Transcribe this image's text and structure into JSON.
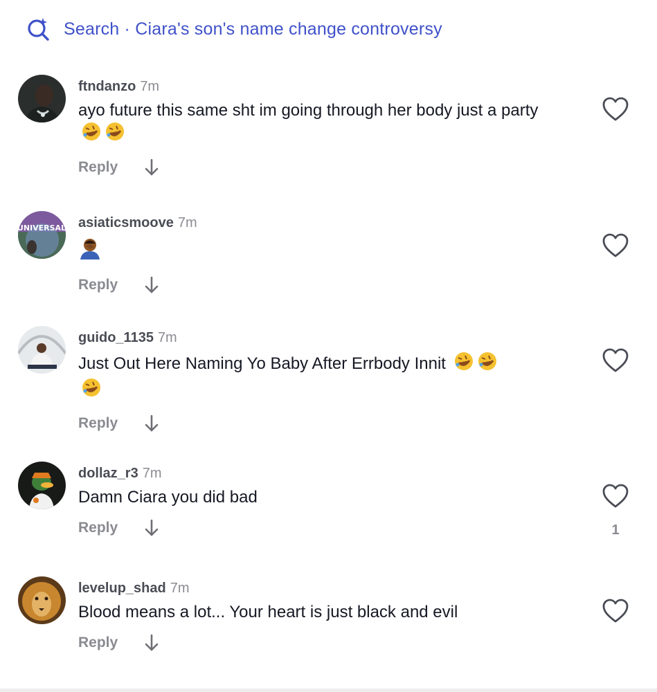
{
  "search": {
    "label": "Search · Ciara's son's name change controversy",
    "icon": "search-sparkle-icon",
    "color": "#3f51c9"
  },
  "comments": [
    {
      "username": "ftndanzo",
      "time": "7m",
      "text": "ayo future this same sht im going through her body just a party",
      "emojis": [
        "rofl-emoji",
        "rofl-emoji"
      ],
      "reply": "Reply",
      "likes": ""
    },
    {
      "username": "asiaticsmoove",
      "time": "7m",
      "text": "",
      "emojis": [
        "facepalm-emoji"
      ],
      "reply": "Reply",
      "likes": ""
    },
    {
      "username": "guido_1135",
      "time": "7m",
      "text": "Just Out Here Naming Yo Baby After Errbody Innit",
      "emojis": [
        "rofl-emoji",
        "rofl-emoji",
        "rofl-emoji"
      ],
      "reply": "Reply",
      "likes": ""
    },
    {
      "username": "dollaz_r3",
      "time": "7m",
      "text": "Damn Ciara you did bad",
      "emojis": [],
      "reply": "Reply",
      "likes": "1"
    },
    {
      "username": "levelup_shad",
      "time": "7m",
      "text": "Blood means a lot... Your heart is just black and evil",
      "emojis": [],
      "reply": "Reply",
      "likes": ""
    }
  ]
}
